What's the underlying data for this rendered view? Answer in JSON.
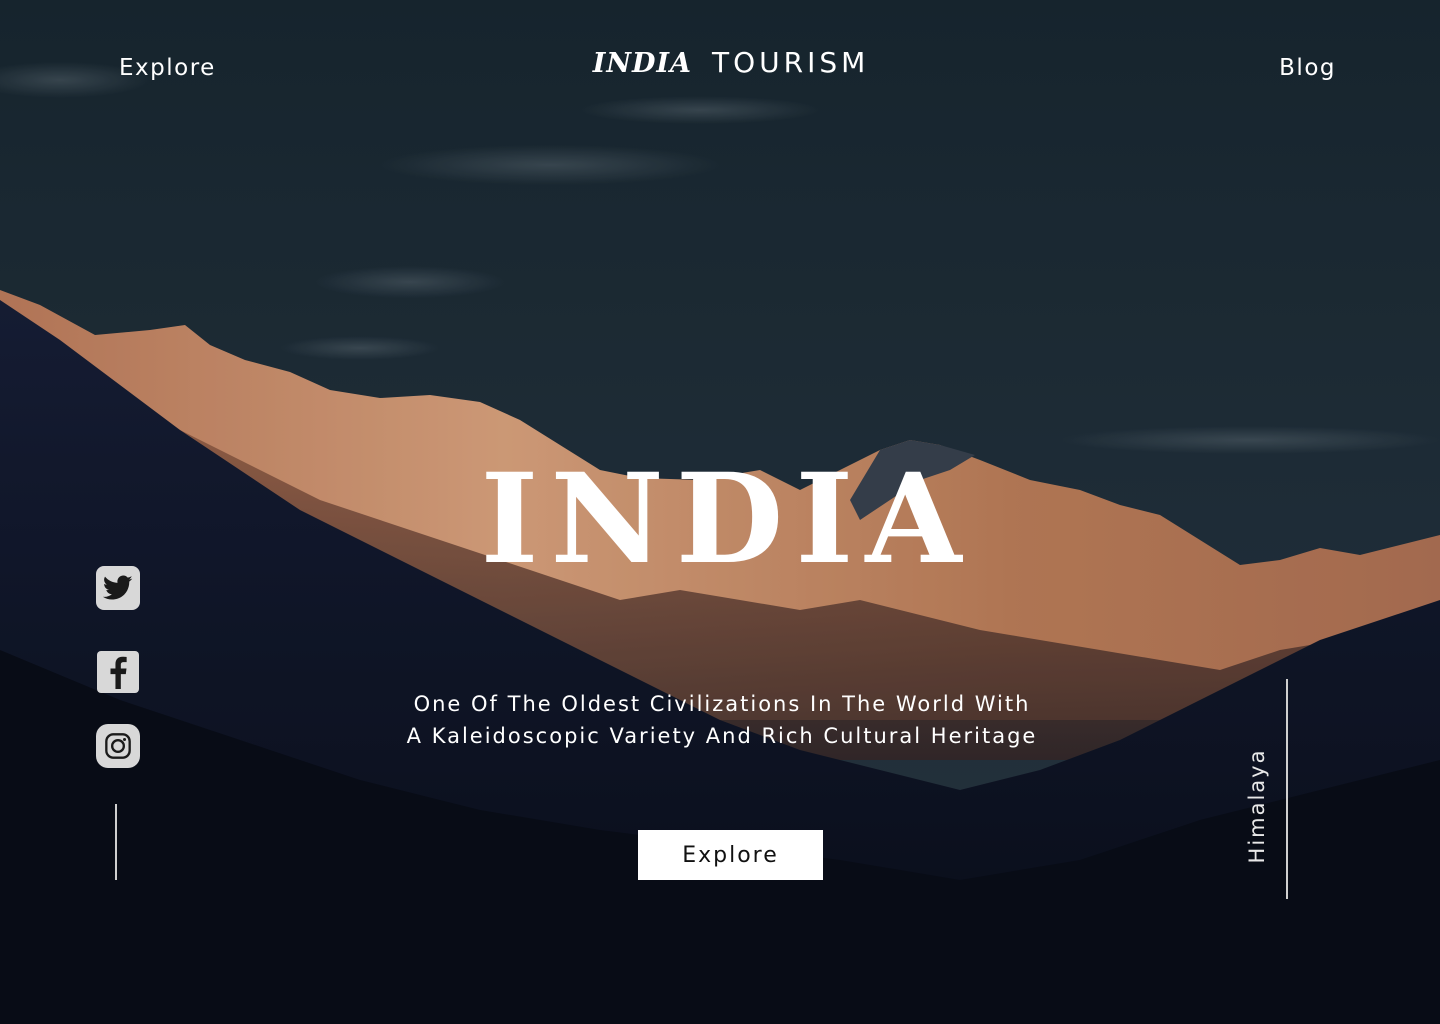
{
  "nav": {
    "left_link": "Explore",
    "right_link": "Blog"
  },
  "brand": {
    "mark": "INDIA",
    "word": "TOURISM"
  },
  "hero": {
    "headline": "INDIA",
    "tagline_line1": "One Of The Oldest Civilizations In The World With",
    "tagline_line2": "A Kaleidoscopic Variety And Rich Cultural Heritage",
    "cta_label": "Explore",
    "side_label": "Himalaya"
  },
  "social": [
    {
      "name": "twitter-icon"
    },
    {
      "name": "facebook-icon"
    },
    {
      "name": "instagram-icon"
    }
  ],
  "colors": {
    "sky_top": "#1b2a35",
    "sky_bottom": "#22323f",
    "peak_lit": "#d9946e",
    "mountain_dark": "#0e1526",
    "icon_bg": "#d8d8d8",
    "text": "#ffffff",
    "button_bg": "#ffffff",
    "button_text": "#111111"
  }
}
